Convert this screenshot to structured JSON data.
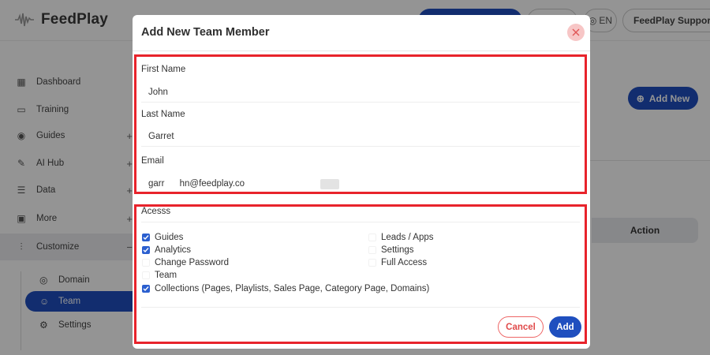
{
  "app": {
    "brand": "FeedPlay",
    "header": {
      "primary_button": "",
      "lang": "EN",
      "support": "FeedPlay Support"
    },
    "sidebar": {
      "items": [
        {
          "label": "Dashboard",
          "icon": "grid-icon"
        },
        {
          "label": "Training",
          "icon": "book-icon"
        },
        {
          "label": "Guides",
          "icon": "compass-icon"
        },
        {
          "label": "AI Hub",
          "icon": "magic-wand-icon"
        },
        {
          "label": "Data",
          "icon": "database-icon"
        },
        {
          "label": "More",
          "icon": "folder-icon"
        },
        {
          "label": "Customize",
          "icon": "sliders-icon"
        }
      ],
      "sub_items": [
        {
          "label": "Domain",
          "icon": "globe-icon"
        },
        {
          "label": "Team",
          "icon": "users-icon"
        },
        {
          "label": "Settings",
          "icon": "gear-icon"
        }
      ]
    },
    "main": {
      "add_new": "Add New",
      "table_action_header": "Action"
    }
  },
  "modal": {
    "title": "Add New Team Member",
    "fields": {
      "first_name_label": "First Name",
      "first_name_value": "John",
      "last_name_label": "Last Name",
      "last_name_value": "Garret",
      "email_label": "Email",
      "email_value": "garr      hn@feedplay.co"
    },
    "access": {
      "title": "Acesss",
      "left": [
        {
          "label": "Guides",
          "checked": true
        },
        {
          "label": "Analytics",
          "checked": true
        },
        {
          "label": "Change Password",
          "checked": false
        },
        {
          "label": "Team",
          "checked": false
        },
        {
          "label": "Collections (Pages, Playlists, Sales Page, Category Page, Domains)",
          "checked": true
        }
      ],
      "right": [
        {
          "label": "Leads / Apps",
          "checked": false
        },
        {
          "label": "Settings",
          "checked": false
        },
        {
          "label": "Full Access",
          "checked": false
        }
      ]
    },
    "buttons": {
      "cancel": "Cancel",
      "add": "Add"
    }
  },
  "colors": {
    "primary": "#1f4fbf",
    "highlight": "#e8232b",
    "checkbox": "#2b5fcf",
    "cancel": "#e04a4a"
  }
}
